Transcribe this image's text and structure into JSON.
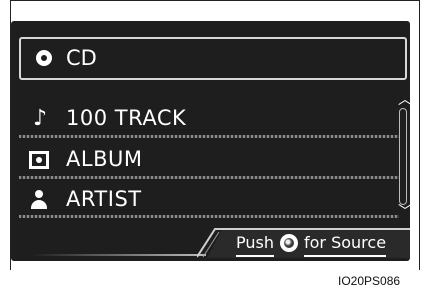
{
  "source": {
    "icon": "disc-icon",
    "label": "CD"
  },
  "list": {
    "items": [
      {
        "icon": "music-note-icon",
        "label": "100 TRACK"
      },
      {
        "icon": "album-icon",
        "label": "ALBUM"
      },
      {
        "icon": "artist-icon",
        "label": "ARTIST"
      }
    ],
    "scroll_up_icon": "chevron-up-icon",
    "scroll_down_icon": "chevron-down-icon"
  },
  "footer": {
    "push_label": "Push",
    "knob_icon": "tune-knob-icon",
    "source_label": "for Source"
  },
  "figure_code": "IO20PS086",
  "colors": {
    "screen_bg": "#1e1e1e",
    "text": "#ffffff",
    "frame": "#222222"
  }
}
